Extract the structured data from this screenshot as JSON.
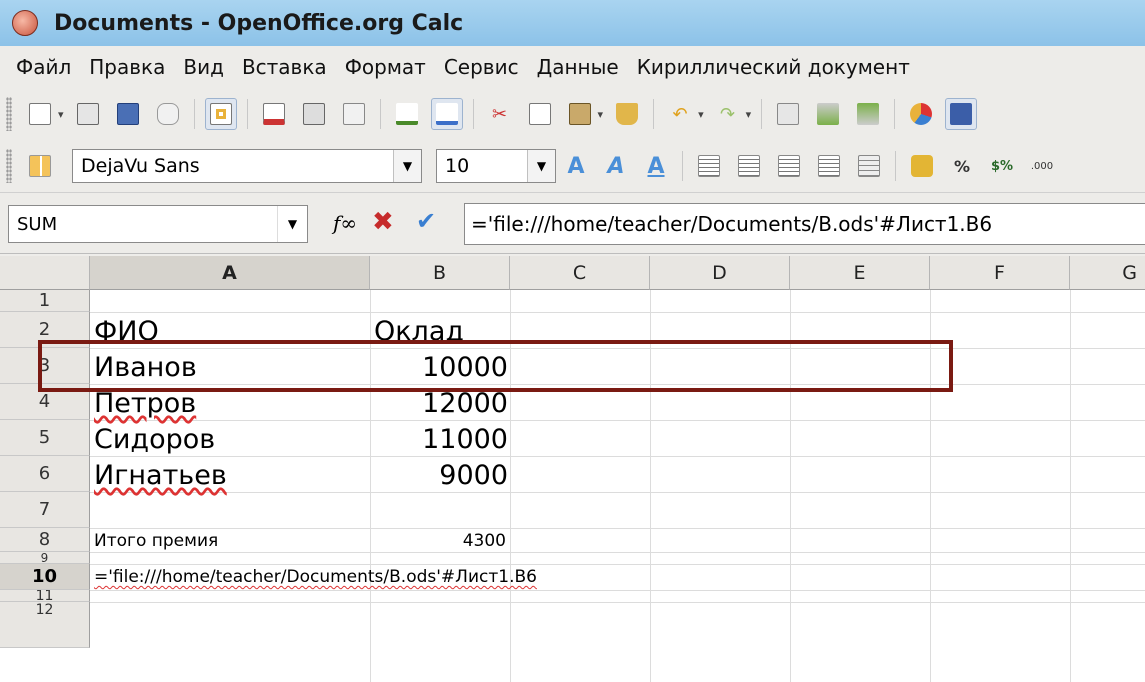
{
  "window": {
    "title": "Documents - OpenOffice.org Calc"
  },
  "menu": [
    "Файл",
    "Правка",
    "Вид",
    "Вставка",
    "Формат",
    "Сервис",
    "Данные",
    "Кириллический документ"
  ],
  "formatting": {
    "font_name": "DejaVu Sans",
    "font_size": "10"
  },
  "formula_bar": {
    "name_box": "SUM",
    "fx_symbol": "f∞",
    "cancel_symbol": "✖",
    "accept_symbol": "✔",
    "content": "='file:///home/teacher/Documents/B.ods'#Лист1.B6"
  },
  "grid": {
    "columns": [
      "A",
      "B",
      "C",
      "D",
      "E",
      "F",
      "G"
    ],
    "rows": [
      "1",
      "2",
      "3",
      "4",
      "5",
      "6",
      "7",
      "8",
      "9",
      "10",
      "11",
      "12"
    ],
    "header_row": {
      "a": "ФИО",
      "b": "Оклад"
    },
    "employees": [
      {
        "name": "Иванов",
        "salary": "10000"
      },
      {
        "name": "Петров",
        "salary": "12000"
      },
      {
        "name": "Сидоров",
        "salary": "11000"
      },
      {
        "name": "Игнатьев",
        "salary": "9000"
      }
    ],
    "total": {
      "label": "Итого премия",
      "value": "4300"
    },
    "editing_cell": {
      "content": "='file:///home/teacher/Documents/B.ods'#Лист1.B6"
    }
  },
  "colors": {
    "highlight_box": "#7a1a12",
    "titlebar": "#9ccbed"
  }
}
